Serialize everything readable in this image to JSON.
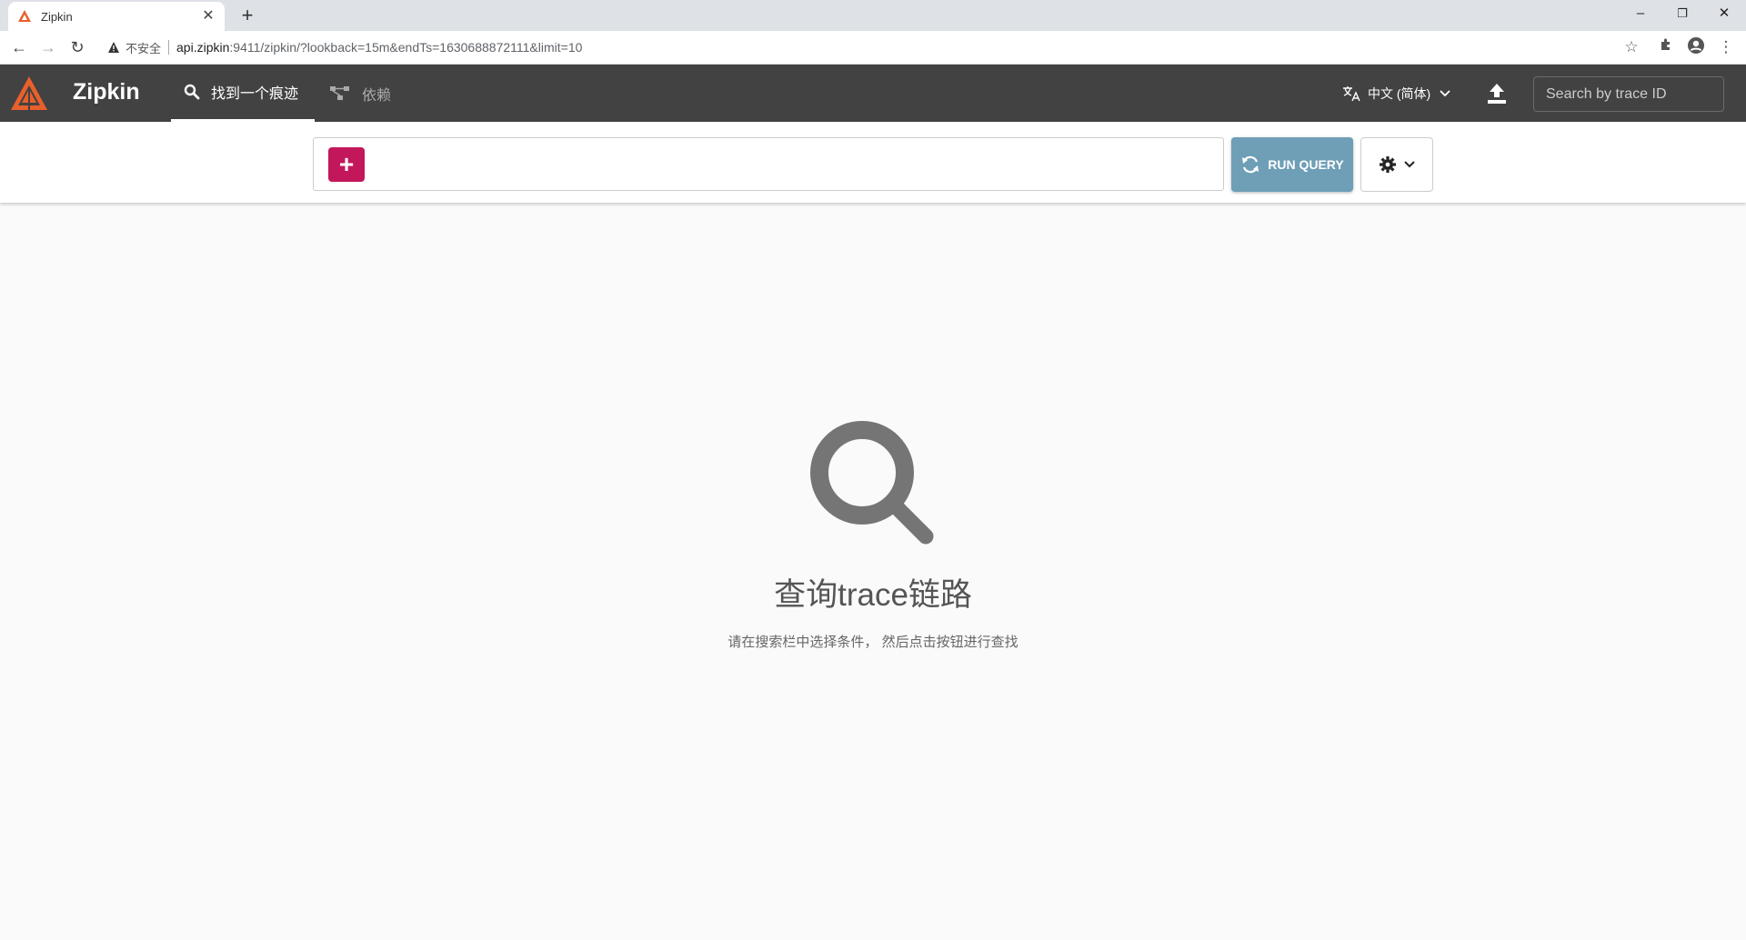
{
  "browser": {
    "tab_title": "Zipkin",
    "security_label": "不安全",
    "url_host": "api.zipkin",
    "url_rest": ":9411/zipkin/?lookback=15m&endTs=1630688872111&limit=10"
  },
  "header": {
    "brand": "Zipkin",
    "tabs": [
      {
        "label": "找到一个痕迹",
        "icon": "search-icon",
        "active": true
      },
      {
        "label": "依赖",
        "icon": "dependencies-icon",
        "active": false
      }
    ],
    "language": "中文 (简体)",
    "trace_search_placeholder": "Search by trace ID"
  },
  "query": {
    "add_label": "+",
    "run_label": "RUN QUERY"
  },
  "empty_state": {
    "title": "查询trace链路",
    "subtitle": "请在搜索栏中选择条件， 然后点击按钮进行查找"
  },
  "colors": {
    "header_bg": "#424242",
    "add_button": "#c2185b",
    "run_button": "#6e9fb7",
    "logo_orange": "#e8602c"
  }
}
